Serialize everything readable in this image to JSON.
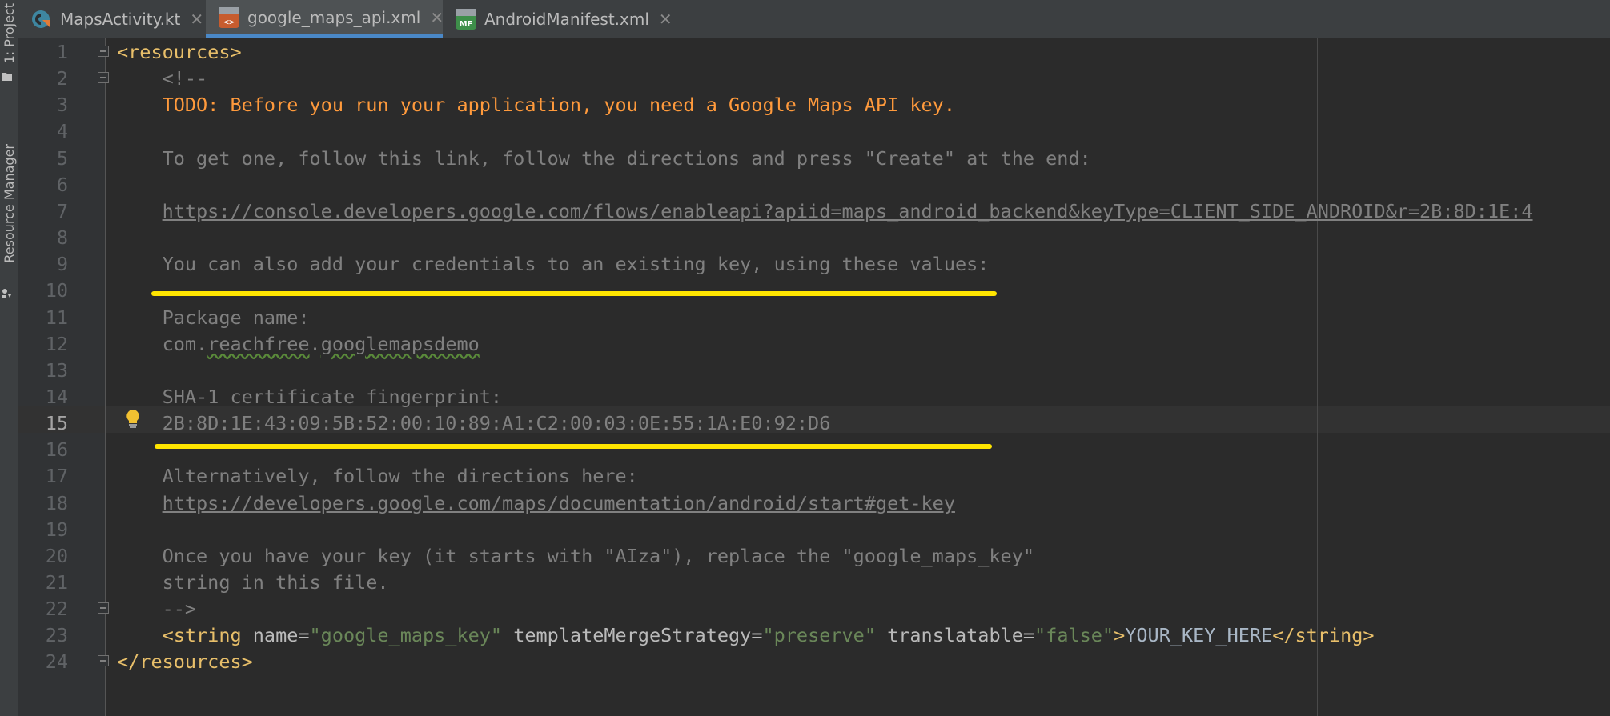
{
  "toolstrip": {
    "project_label": "1: Project",
    "resource_manager_label": "Resource Manager"
  },
  "tabs": [
    {
      "label": "MapsActivity.kt",
      "icon": "kotlin-file-icon",
      "active": false
    },
    {
      "label": "google_maps_api.xml",
      "icon": "xml-file-icon",
      "active": true
    },
    {
      "label": "AndroidManifest.xml",
      "icon": "manifest-file-icon",
      "active": false
    }
  ],
  "editor": {
    "current_line": 15,
    "lines": [
      {
        "n": "1",
        "parts": [
          {
            "t": "<resources>",
            "c": "c-tag"
          }
        ]
      },
      {
        "n": "2",
        "parts": [
          {
            "t": "    <!--",
            "c": "c-comment"
          }
        ]
      },
      {
        "n": "3",
        "parts": [
          {
            "t": "    TODO: Before you run your application, you need a Google Maps API key.",
            "c": "c-todo"
          }
        ]
      },
      {
        "n": "4",
        "parts": []
      },
      {
        "n": "5",
        "parts": [
          {
            "t": "    To get one, follow this link, follow the directions and press \"Create\" at the end:",
            "c": "c-comment"
          }
        ]
      },
      {
        "n": "6",
        "parts": []
      },
      {
        "n": "7",
        "parts": [
          {
            "t": "    ",
            "c": "c-comment"
          },
          {
            "t": "https://console.developers.google.com/flows/enableapi?apiid=maps_android_backend&keyType=CLIENT_SIDE_ANDROID&r=2B:8D:1E:4",
            "c": "c-link"
          }
        ]
      },
      {
        "n": "8",
        "parts": []
      },
      {
        "n": "9",
        "parts": [
          {
            "t": "    You can also add your credentials to an existing key, using these values:",
            "c": "c-comment"
          }
        ]
      },
      {
        "n": "10",
        "parts": []
      },
      {
        "n": "11",
        "parts": [
          {
            "t": "    Package name:",
            "c": "c-comment"
          }
        ]
      },
      {
        "n": "12",
        "parts": [
          {
            "t": "    com.",
            "c": "c-comment"
          },
          {
            "t": "reachfree",
            "c": "c-comment typo"
          },
          {
            "t": ".",
            "c": "c-comment"
          },
          {
            "t": "googlemapsdemo",
            "c": "c-comment typo"
          }
        ]
      },
      {
        "n": "13",
        "parts": []
      },
      {
        "n": "14",
        "parts": [
          {
            "t": "    SHA-1 certificate fingerprint:",
            "c": "c-comment"
          }
        ]
      },
      {
        "n": "15",
        "parts": [
          {
            "t": "    2B:8D:1E:43:09:5B:52:00:10:89:A1:C2:00:03:0E:55:1A:E0:92:D6",
            "c": "c-comment"
          }
        ]
      },
      {
        "n": "16",
        "parts": []
      },
      {
        "n": "17",
        "parts": [
          {
            "t": "    Alternatively, follow the directions here:",
            "c": "c-comment"
          }
        ]
      },
      {
        "n": "18",
        "parts": [
          {
            "t": "    ",
            "c": "c-comment"
          },
          {
            "t": "https://developers.google.com/maps/documentation/android/start#get-key",
            "c": "c-link"
          }
        ]
      },
      {
        "n": "19",
        "parts": []
      },
      {
        "n": "20",
        "parts": [
          {
            "t": "    Once you have your key (it starts with \"AIza\"), replace the \"google_maps_key\"",
            "c": "c-comment"
          }
        ]
      },
      {
        "n": "21",
        "parts": [
          {
            "t": "    string in this file.",
            "c": "c-comment"
          }
        ]
      },
      {
        "n": "22",
        "parts": [
          {
            "t": "    -->",
            "c": "c-comment"
          }
        ]
      },
      {
        "n": "23",
        "parts": [
          {
            "t": "    <string ",
            "c": "c-tag"
          },
          {
            "t": "name=",
            "c": "c-attr"
          },
          {
            "t": "\"google_maps_key\"",
            "c": "c-val"
          },
          {
            "t": " templateMergeStrategy=",
            "c": "c-attr"
          },
          {
            "t": "\"preserve\"",
            "c": "c-val"
          },
          {
            "t": " translatable=",
            "c": "c-attr"
          },
          {
            "t": "\"false\"",
            "c": "c-val"
          },
          {
            "t": ">",
            "c": "c-tag"
          },
          {
            "t": "YOUR_KEY_HERE",
            "c": "c-text"
          },
          {
            "t": "</string>",
            "c": "c-tag"
          }
        ]
      },
      {
        "n": "24",
        "parts": [
          {
            "t": "</resources>",
            "c": "c-tag"
          }
        ]
      }
    ],
    "fold_lines": [
      1,
      2,
      22,
      24
    ],
    "highlight_color": "#ffe500"
  }
}
